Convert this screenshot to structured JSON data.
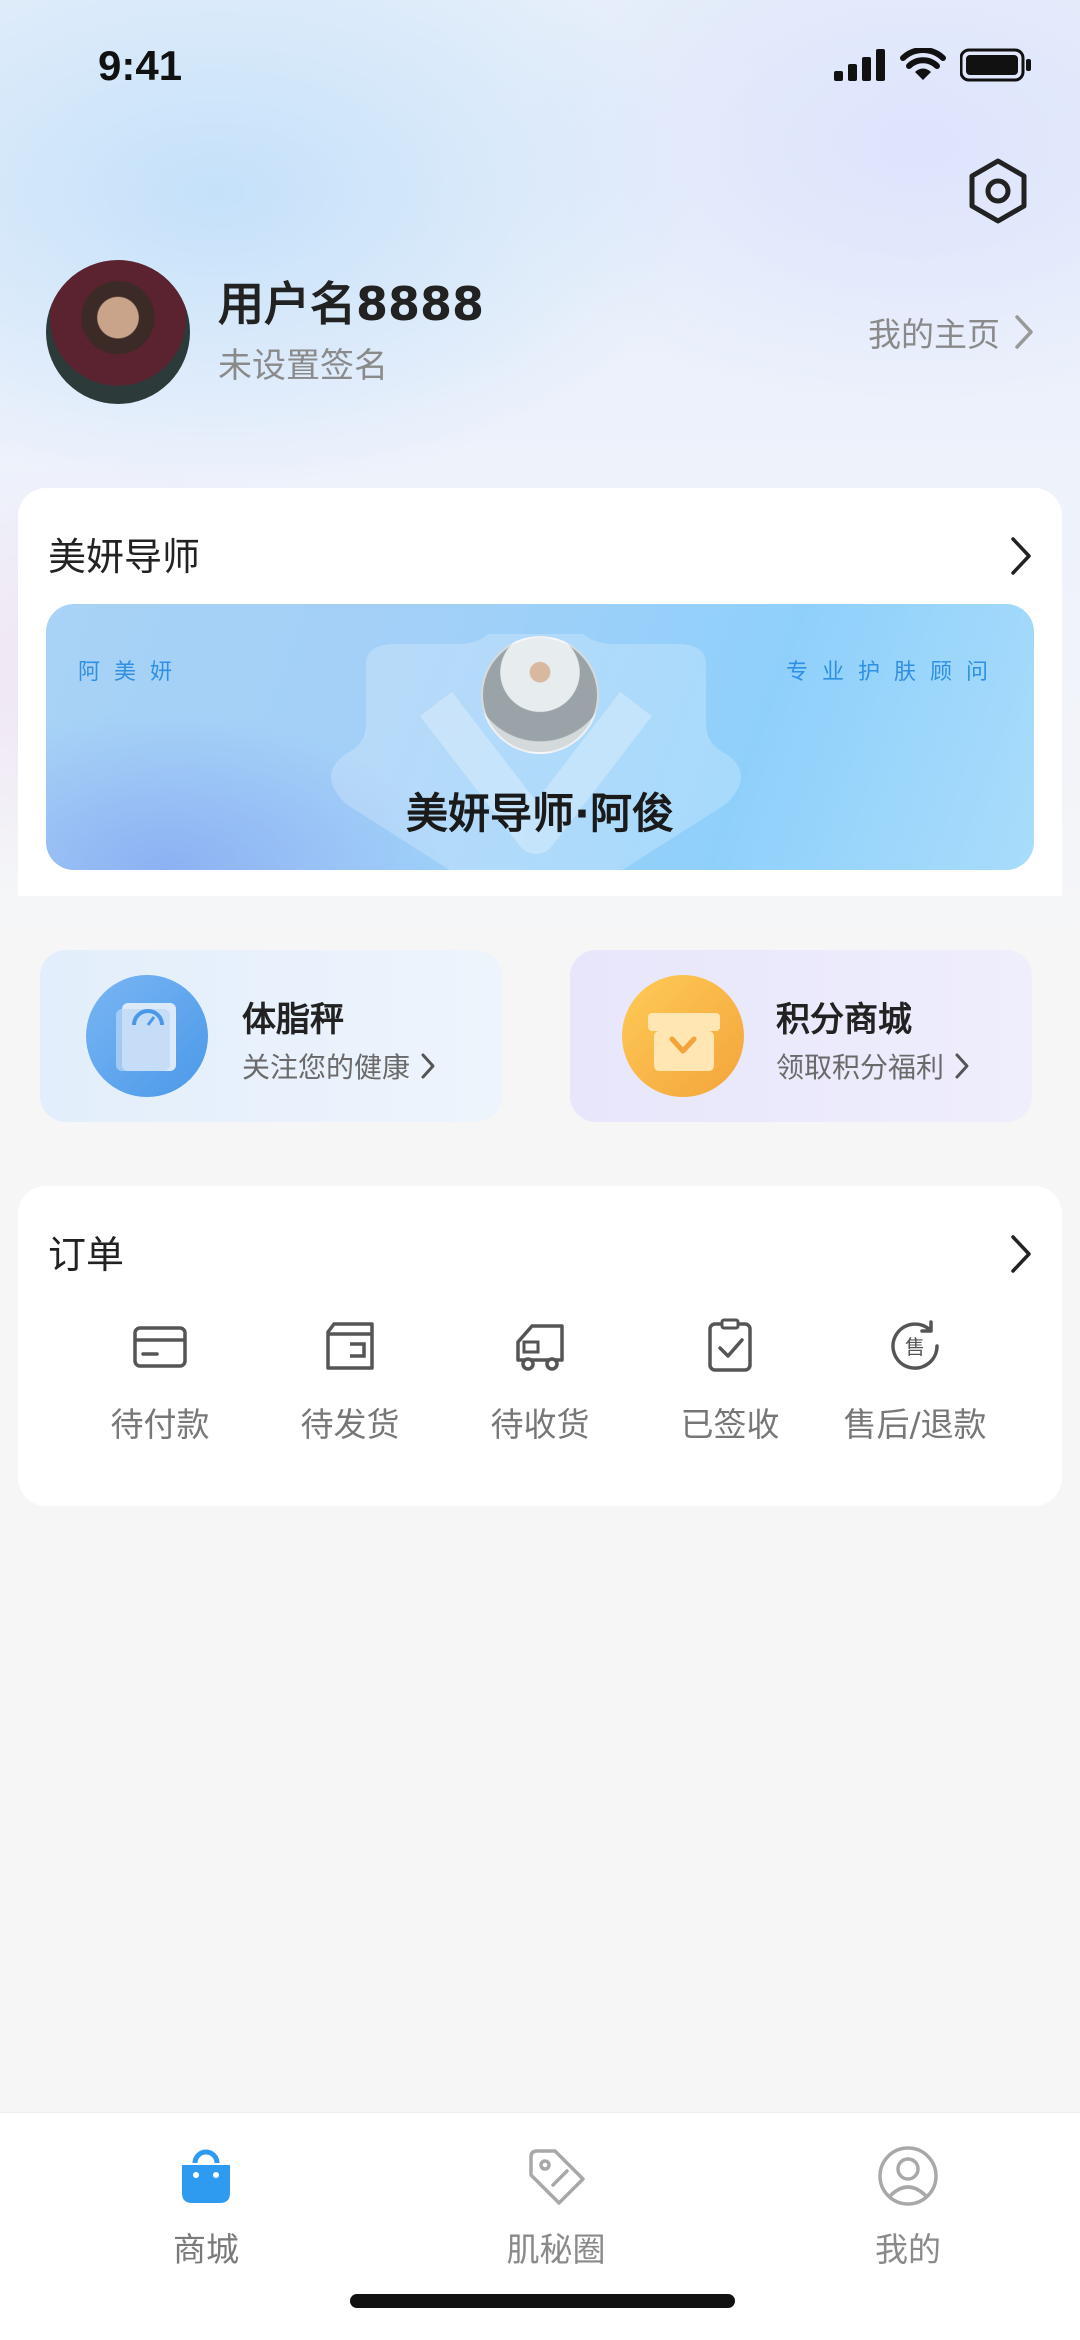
{
  "status_bar": {
    "time": "9:41"
  },
  "profile": {
    "username": "用户名8888",
    "signature": "未设置签名",
    "homepage_link": "我的主页"
  },
  "advisor": {
    "section_title": "美妍导师",
    "brand_tag": "阿美妍",
    "pro_tag": "专业护肤顾问",
    "name": "美妍导师·阿俊"
  },
  "features": [
    {
      "title": "体脂秤",
      "subtitle": "关注您的健康",
      "icon": "scale-icon"
    },
    {
      "title": "积分商城",
      "subtitle": "领取积分福利",
      "icon": "gift-icon"
    }
  ],
  "orders": {
    "section_title": "订单",
    "items": [
      {
        "label": "待付款",
        "icon": "card-icon"
      },
      {
        "label": "待发货",
        "icon": "box-icon"
      },
      {
        "label": "待收货",
        "icon": "truck-icon"
      },
      {
        "label": "已签收",
        "icon": "clipboard-check-icon"
      },
      {
        "label": "售后/退款",
        "icon": "after-sale-icon"
      }
    ]
  },
  "tab_bar": {
    "items": [
      {
        "label": "商城",
        "icon": "shopping-bag-icon",
        "active": true
      },
      {
        "label": "肌秘圈",
        "icon": "tag-icon",
        "active": false
      },
      {
        "label": "我的",
        "icon": "user-icon",
        "active": false
      }
    ]
  },
  "colors": {
    "accent": "#2f9bf0",
    "brand_text": "#2f8fe3",
    "gift": "#f3a43a"
  }
}
